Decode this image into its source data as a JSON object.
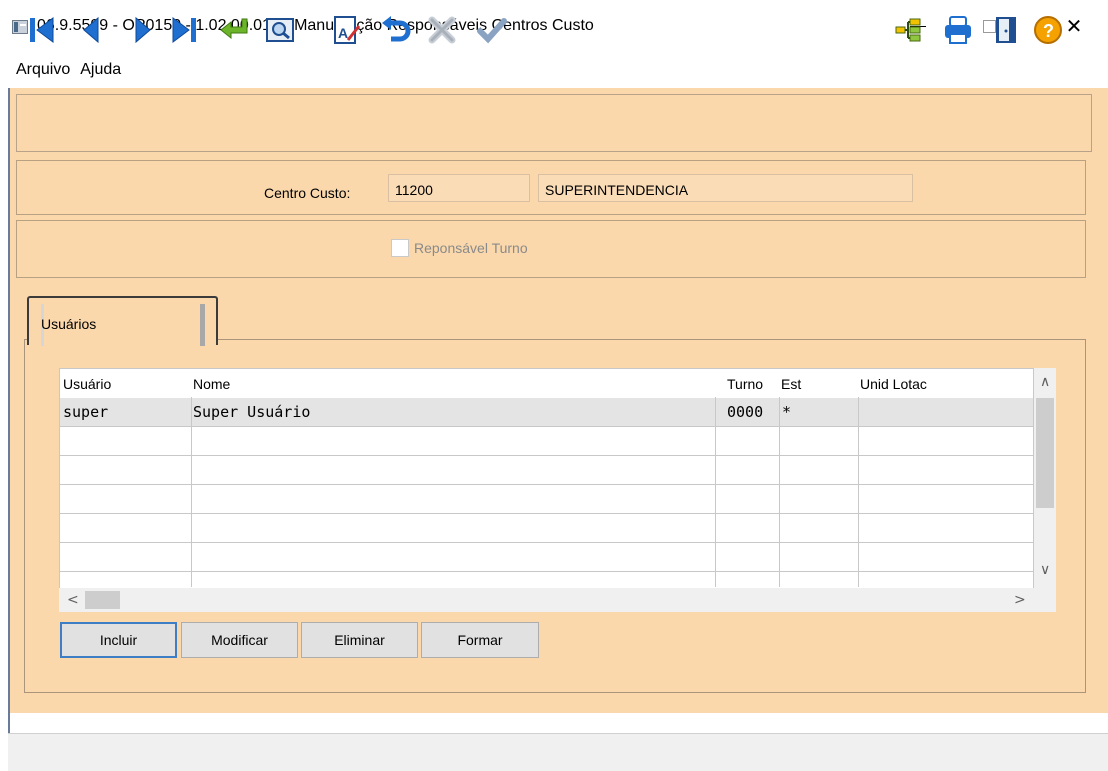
{
  "window": {
    "title": "06.9.5599 - OP0150 - 1.02.00.012 - Manutenção Responsáveis Centros Custo",
    "minimize_icon": "minimize-icon",
    "maximize_icon": "maximize-icon",
    "close_icon": "close-icon",
    "close_glyph": "✕"
  },
  "menu": [
    "Arquivo",
    "Ajuda"
  ],
  "toolbar": {
    "left_icons": [
      "first-record-icon",
      "previous-record-icon",
      "next-record-icon",
      "last-record-icon",
      "goto-icon",
      "search-icon",
      "edit-icon",
      "undo-icon",
      "cancel-icon",
      "confirm-icon"
    ],
    "right_icons": [
      "navigation-tree-icon",
      "print-icon",
      "exit-door-icon",
      "help-icon"
    ],
    "help_glyph": "?"
  },
  "form": {
    "centro_custo_label": "Centro Custo:",
    "centro_custo_code": "11200",
    "centro_custo_desc": "SUPERINTENDENCIA",
    "responsavel_turno_label": "Reponsável Turno",
    "responsavel_turno_checked": false
  },
  "tab": {
    "label": "Usuários"
  },
  "grid": {
    "columns": [
      "Usuário",
      "Nome",
      "Turno",
      "Est",
      "Unid Lotac"
    ],
    "rows": [
      {
        "usuario": "super",
        "nome": "Super Usuário",
        "turno": "0000",
        "est": "*",
        "unid_lotac": ""
      }
    ]
  },
  "scroll": {
    "up": "∧",
    "down": "∨",
    "left": "<",
    "right": ">"
  },
  "buttons": {
    "incluir": "Incluir",
    "modificar": "Modificar",
    "eliminar": "Eliminar",
    "formar": "Formar"
  },
  "colors": {
    "panel_bg": "#fad8ac",
    "toolbar_icon_blue": "#1f6fd0",
    "confirm_green": "#5f9a1e",
    "help_orange": "#f5a100"
  }
}
